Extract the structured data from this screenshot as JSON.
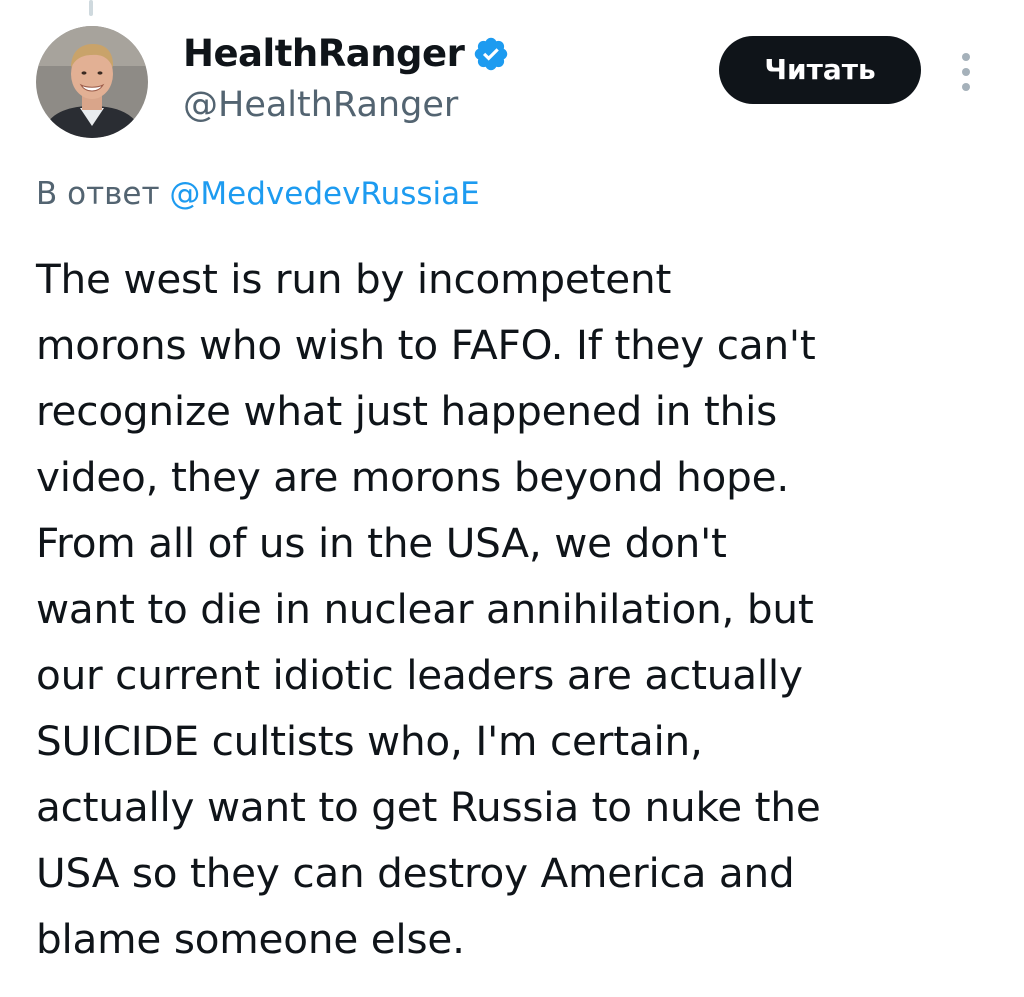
{
  "author": {
    "display_name": "HealthRanger",
    "username": "@HealthRanger",
    "verified": true,
    "avatar": "profile-photo"
  },
  "follow_button": {
    "label": "Читать"
  },
  "more_menu": {
    "icon": "more-vertical-icon"
  },
  "reply_to": {
    "prefix": "В ответ",
    "handle": "@MedvedevRussiaE"
  },
  "tweet": {
    "lines": [
      "The west is run by incompetent",
      "morons who wish to FAFO. If they can't",
      "recognize what just happened in this",
      "video, they are morons beyond hope.",
      "From all of us in the USA, we don't",
      "want to die in nuclear annihilation, but",
      "our current idiotic leaders are actually",
      "SUICIDE cultists who, I'm certain,",
      "actually want to get Russia to nuke the",
      "USA so they can destroy America and",
      "blame someone else."
    ]
  },
  "colors": {
    "text_primary": "#0f1419",
    "text_secondary": "#536471",
    "link_blue": "#1d9bf0",
    "verified_blue": "#1d9bf0",
    "button_bg": "#0f1419",
    "button_text": "#ffffff"
  }
}
